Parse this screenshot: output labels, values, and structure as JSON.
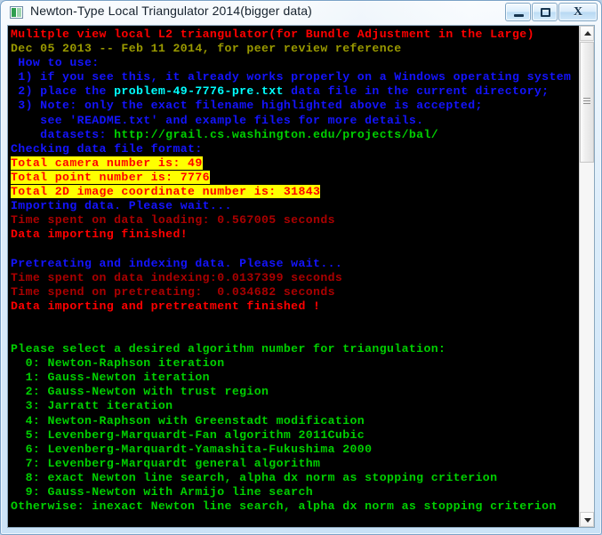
{
  "window": {
    "title": "Newton-Type Local Triangulator 2014(bigger data)",
    "icon": "console-app-icon",
    "buttons": {
      "minimize": "minimize-button",
      "maximize": "maximize-button",
      "close_label": "X"
    }
  },
  "colors": {
    "red": "#ff0000",
    "dark_red": "#aa0000",
    "olive": "#9a9a00",
    "blue": "#1414ff",
    "cyan": "#00ffff",
    "green": "#00d000",
    "highlight_bg": "#ffff00",
    "console_bg": "#000000"
  },
  "console": {
    "lines": [
      {
        "id": "title-banner",
        "text": "Mulitple view local L2 triangulator(for Bundle Adjustment in the Large)"
      },
      {
        "id": "date-line",
        "text": "Dec 05 2013 -- Feb 11 2014, for peer review reference"
      },
      {
        "id": "how-to-use",
        "text": " How to use:"
      },
      {
        "id": "step-1",
        "text": " 1) if you see this, it already works properly on a Windows operating system"
      },
      {
        "id": "step-2a",
        "text": " 2) place the "
      },
      {
        "id": "step-2-filename",
        "text": "problem-49-7776-pre.txt"
      },
      {
        "id": "step-2b",
        "text": " data file in the current directory;"
      },
      {
        "id": "step-3",
        "text": " 3) Note: only the exact filename highlighted above is accepted;"
      },
      {
        "id": "readme-line",
        "text": "    see 'README.txt' and example files for more details."
      },
      {
        "id": "datasets-label",
        "text": "    datasets: "
      },
      {
        "id": "datasets-url",
        "text": "http://grail.cs.washington.edu/projects/bal/"
      },
      {
        "id": "checking-format",
        "text": "Checking data file format:"
      },
      {
        "id": "total-camera",
        "text": "Total camera number is: 49"
      },
      {
        "id": "total-point",
        "text": "Total point number is: 7776"
      },
      {
        "id": "total-2d",
        "text": "Total 2D image coordinate number is: 31843"
      },
      {
        "id": "importing-data",
        "text": "Importing data. Please wait..."
      },
      {
        "id": "time-loading",
        "text": "Time spent on data loading: 0.567005 seconds"
      },
      {
        "id": "import-finished",
        "text": "Data importing finished!"
      },
      {
        "id": "pretreating",
        "text": "Pretreating and indexing data. Please wait..."
      },
      {
        "id": "time-indexing",
        "text": "Time spent on data indexing:0.0137399 seconds"
      },
      {
        "id": "time-pretreating",
        "text": "Time spend on pretreating:  0.034682 seconds"
      },
      {
        "id": "pretreat-finished",
        "text": "Data importing and pretreatment finished !"
      },
      {
        "id": "prompt",
        "text": "Please select a desired algorithm number for triangulation:"
      },
      {
        "id": "algo-0",
        "text": "  0: Newton-Raphson iteration"
      },
      {
        "id": "algo-1",
        "text": "  1: Gauss-Newton iteration"
      },
      {
        "id": "algo-2",
        "text": "  2: Gauss-Newton with trust region"
      },
      {
        "id": "algo-3",
        "text": "  3: Jarratt iteration"
      },
      {
        "id": "algo-4",
        "text": "  4: Newton-Raphson with Greenstadt modification"
      },
      {
        "id": "algo-5",
        "text": "  5: Levenberg-Marquardt-Fan algorithm 2011Cubic"
      },
      {
        "id": "algo-6",
        "text": "  6: Levenberg-Marquardt-Yamashita-Fukushima 2000"
      },
      {
        "id": "algo-7",
        "text": "  7: Levenberg-Marquardt general algorithm"
      },
      {
        "id": "algo-8",
        "text": "  8: exact Newton line search, alpha dx norm as stopping criterion"
      },
      {
        "id": "algo-9",
        "text": "  9: Gauss-Newton with Armijo line search"
      },
      {
        "id": "algo-otherwise",
        "text": "Otherwise: inexact Newton line search, alpha dx norm as stopping criterion"
      }
    ]
  },
  "scrollbar": {
    "up_arrow": "scroll-up-arrow",
    "down_arrow": "scroll-down-arrow",
    "thumb": "scroll-thumb"
  }
}
